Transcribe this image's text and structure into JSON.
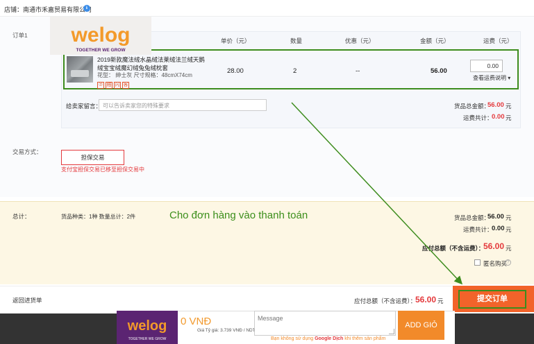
{
  "shop": {
    "label": "店铺：南通市禾嘉贸易有限公司",
    "badge": "ℹ"
  },
  "order": {
    "section_label": "订单1",
    "headers": {
      "price": "单价（元）",
      "qty": "数量",
      "discount": "优惠（元）",
      "amount": "金额（元）",
      "shipping": "运费（元）"
    },
    "product": {
      "title": "2019新款魔法绒水晶绒法莱绒法兰绒天鹅绒宝宝绒魔幻绒兔兔绒枕套",
      "spec": "花型：  绅士灰     尺寸规格：48cmX74cm",
      "icons": [
        "⑦",
        "赔",
        "闪",
        "客"
      ],
      "price": "28.00",
      "qty": "2",
      "discount": "--",
      "amount": "56.00",
      "shipping_value": "0.00",
      "shipping_link": "查看运费说明 ▾"
    },
    "message_label": "给卖家留言：",
    "message_placeholder": "可以告诉卖家您的特殊要求",
    "goods_total_label": "货品总金额：",
    "goods_total": "56.00",
    "shipping_total_label": "运费共计：",
    "shipping_total": "0.00",
    "unit": "元"
  },
  "payment": {
    "label": "交易方式：",
    "button": "担保交易",
    "note": "支付宝担保交易已移至担保交易中"
  },
  "summary": {
    "label": "总计：",
    "kinds": "货品种类：1种   数量总计：2件",
    "cta": "Cho đơn hàng vào thanh toán",
    "goods_total_label": "货品总金额：",
    "goods_total": "56.00",
    "shipping_label": "运费共计：",
    "shipping": "0.00",
    "payable_label": "应付总额（不含运费）：",
    "payable": "56.00",
    "unit": "元",
    "anonymous": "匿名购买"
  },
  "bottom": {
    "back": "返回进货单",
    "payable_label": "应付总额（不含运费）：",
    "payable": "56.00",
    "unit": "元",
    "submit": "提交订单"
  },
  "plugin": {
    "amount": "0 VNĐ",
    "rate": "Giá Tỷ giá: 3.739 VNĐ / NDT",
    "message_placeholder": "Message",
    "add_button": "ADD GIỎ",
    "note_prefix": "Bạn không sử dụng ",
    "note_link": "Google Dịch",
    "note_suffix": " khi thêm sản phẩm"
  },
  "logo": {
    "text": "welog",
    "tagline": "TOGETHER WE GROW"
  },
  "colors": {
    "accent_red": "#e4393c",
    "submit_orange": "#f2632a",
    "highlight_green": "#3d8c1d",
    "plugin_orange": "#f28a2a"
  }
}
